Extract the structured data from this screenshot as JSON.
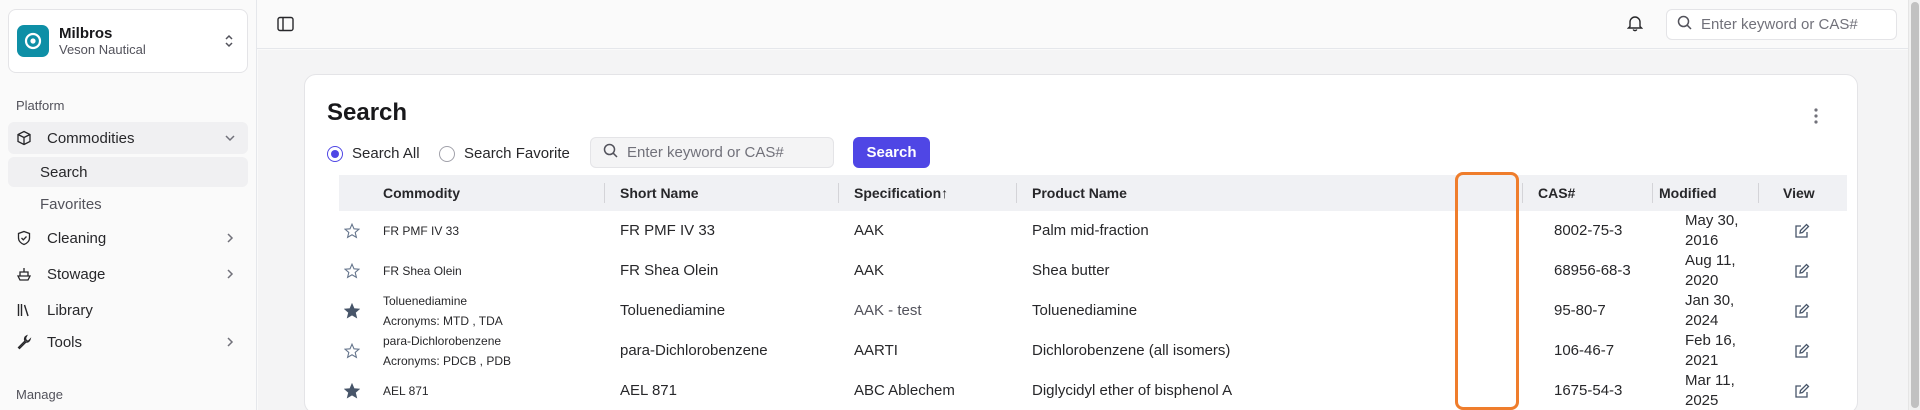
{
  "org": {
    "name": "Milbros",
    "subtitle": "Veson Nautical"
  },
  "sidebar": {
    "group_platform": "Platform",
    "group_manage": "Manage",
    "items": [
      {
        "label": "Commodities"
      },
      {
        "label": "Cleaning"
      },
      {
        "label": "Stowage"
      },
      {
        "label": "Library"
      },
      {
        "label": "Tools"
      }
    ],
    "sub_items": [
      {
        "label": "Search"
      },
      {
        "label": "Favorites"
      }
    ]
  },
  "topbar": {
    "search_placeholder": "Enter keyword or CAS#"
  },
  "search": {
    "title": "Search",
    "radio_all": "Search All",
    "radio_favorite": "Search Favorite",
    "placeholder": "Enter keyword or CAS#",
    "button": "Search"
  },
  "table": {
    "headers": [
      "Commodity",
      "Short Name",
      "Specification↑",
      "Product Name",
      "CAS#",
      "Modified",
      "View"
    ],
    "rows": [
      {
        "commodity": "FR PMF IV 33",
        "acronyms": "",
        "short": "FR PMF IV 33",
        "spec": "AAK",
        "product": "Palm mid-fraction",
        "cas": "8002-75-3",
        "modified_1": "May 30,",
        "modified_2": "2016",
        "favorite": false
      },
      {
        "commodity": "FR Shea Olein",
        "acronyms": "",
        "short": "FR Shea Olein",
        "spec": "AAK",
        "product": "Shea butter",
        "cas": "68956-68-3",
        "modified_1": "Aug 11,",
        "modified_2": "2020",
        "favorite": false
      },
      {
        "commodity": "Toluenediamine",
        "acronyms": "Acronyms: MTD , TDA",
        "short": "Toluenediamine",
        "spec": "AAK - test",
        "product": "Toluenediamine",
        "cas": "95-80-7",
        "modified_1": "Jan 30,",
        "modified_2": "2024",
        "favorite": true
      },
      {
        "commodity": "para-Dichlorobenzene",
        "acronyms": "Acronyms: PDCB , PDB",
        "short": "para-Dichlorobenzene",
        "spec": "AARTI",
        "product": "Dichlorobenzene (all isomers)",
        "cas": "106-46-7",
        "modified_1": "Feb 16,",
        "modified_2": "2021",
        "favorite": false
      },
      {
        "commodity": "AEL 871",
        "acronyms": "",
        "short": "AEL 871",
        "spec": "ABC Ablechem",
        "product": "Diglycidyl ether of bisphenol A",
        "cas": "1675-54-3",
        "modified_1": "Mar 11,",
        "modified_2": "2025",
        "favorite": true
      }
    ]
  },
  "colors": {
    "primary": "#4f46e5",
    "highlight": "#ef7d2c",
    "brand": "#0e8fa6"
  }
}
